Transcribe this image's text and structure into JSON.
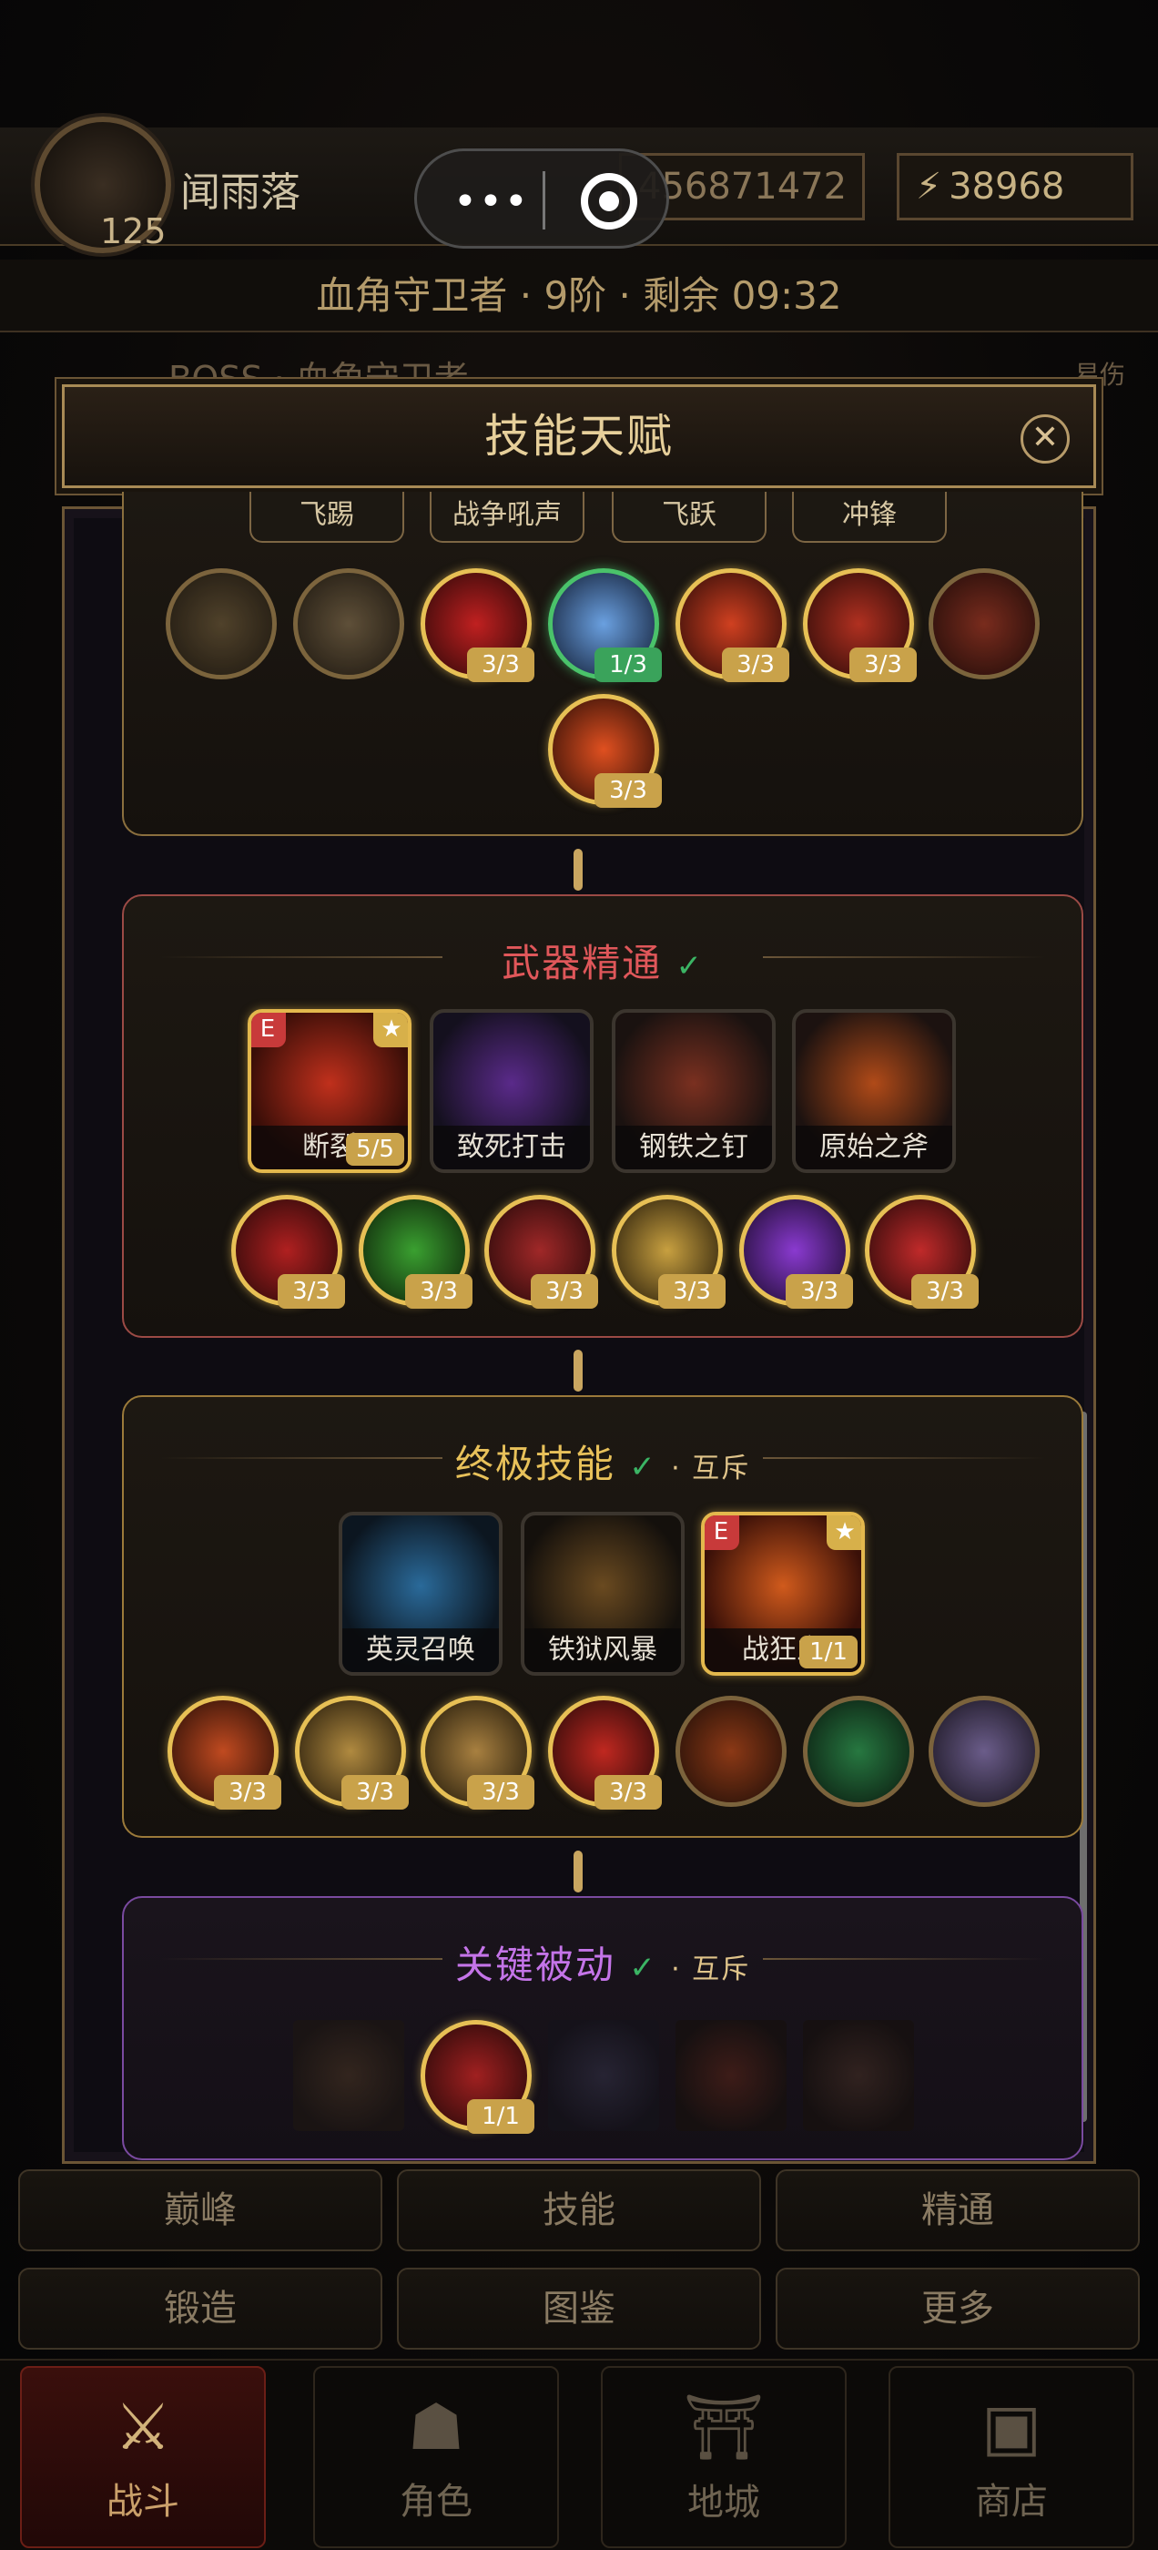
{
  "header": {
    "player_name": "闻雨落",
    "level": "125",
    "currency_1": "456871472",
    "currency_2": "38968"
  },
  "boss_bar": {
    "status_text": "血角守卫者 · 9阶 · 剩余 09:32",
    "boss_label": "BOSS · 血角守卫者",
    "damage_label": "易伤"
  },
  "modal": {
    "title": "技能天赋",
    "close_icon": "close-icon"
  },
  "top_section": {
    "tabs": [
      "飞踢",
      "战争吼声",
      "飞跃",
      "冲锋"
    ],
    "nodes": [
      {
        "badge": "",
        "icon": "dial-icon"
      },
      {
        "badge": "",
        "icon": "crown-icon"
      },
      {
        "badge": "3/3",
        "icon": "red-slash-icon"
      },
      {
        "badge": "1/3",
        "icon": "blue-spear-icon"
      },
      {
        "badge": "3/3",
        "icon": "heart-icon"
      },
      {
        "badge": "3/3",
        "icon": "crab-icon"
      },
      {
        "badge": "",
        "icon": "crossed-blades-icon"
      },
      {
        "badge": "3/3",
        "icon": "fire-fist-icon"
      }
    ]
  },
  "weapon_section": {
    "title": "武器精通",
    "title_color": "#e0575a",
    "cards": [
      {
        "label": "断裂",
        "badge": "5/5",
        "e": "E",
        "star": "★"
      },
      {
        "label": "致死打击"
      },
      {
        "label": "钢铁之钉"
      },
      {
        "label": "原始之斧"
      }
    ],
    "nodes": [
      "3/3",
      "3/3",
      "3/3",
      "3/3",
      "3/3",
      "3/3"
    ]
  },
  "ultimate_section": {
    "title": "终极技能",
    "title_color": "#e8c15a",
    "mutex": "· 互斥",
    "cards": [
      {
        "label": "英灵召唤"
      },
      {
        "label": "铁狱风暴"
      },
      {
        "label": "战狂之",
        "badge": "1/1",
        "e": "E",
        "star": "★"
      }
    ],
    "nodes": [
      "3/3",
      "3/3",
      "3/3",
      "3/3",
      "",
      "",
      ""
    ]
  },
  "passive_section": {
    "title": "关键被动",
    "title_color": "#c474e8",
    "mutex": "· 互斥",
    "nodes": [
      "",
      "1/1",
      "",
      "",
      ""
    ]
  },
  "menu": {
    "row1": [
      "巅峰",
      "技能",
      "精通"
    ],
    "row2": [
      "锻造",
      "图鉴",
      "更多"
    ]
  },
  "nav": [
    {
      "label": "战斗",
      "icon": "crossed-swords-icon",
      "active": true
    },
    {
      "label": "角色",
      "icon": "helmet-icon",
      "active": false
    },
    {
      "label": "地城",
      "icon": "gate-icon",
      "active": false
    },
    {
      "label": "商店",
      "icon": "chest-icon",
      "active": false
    }
  ],
  "check_mark": "✓"
}
